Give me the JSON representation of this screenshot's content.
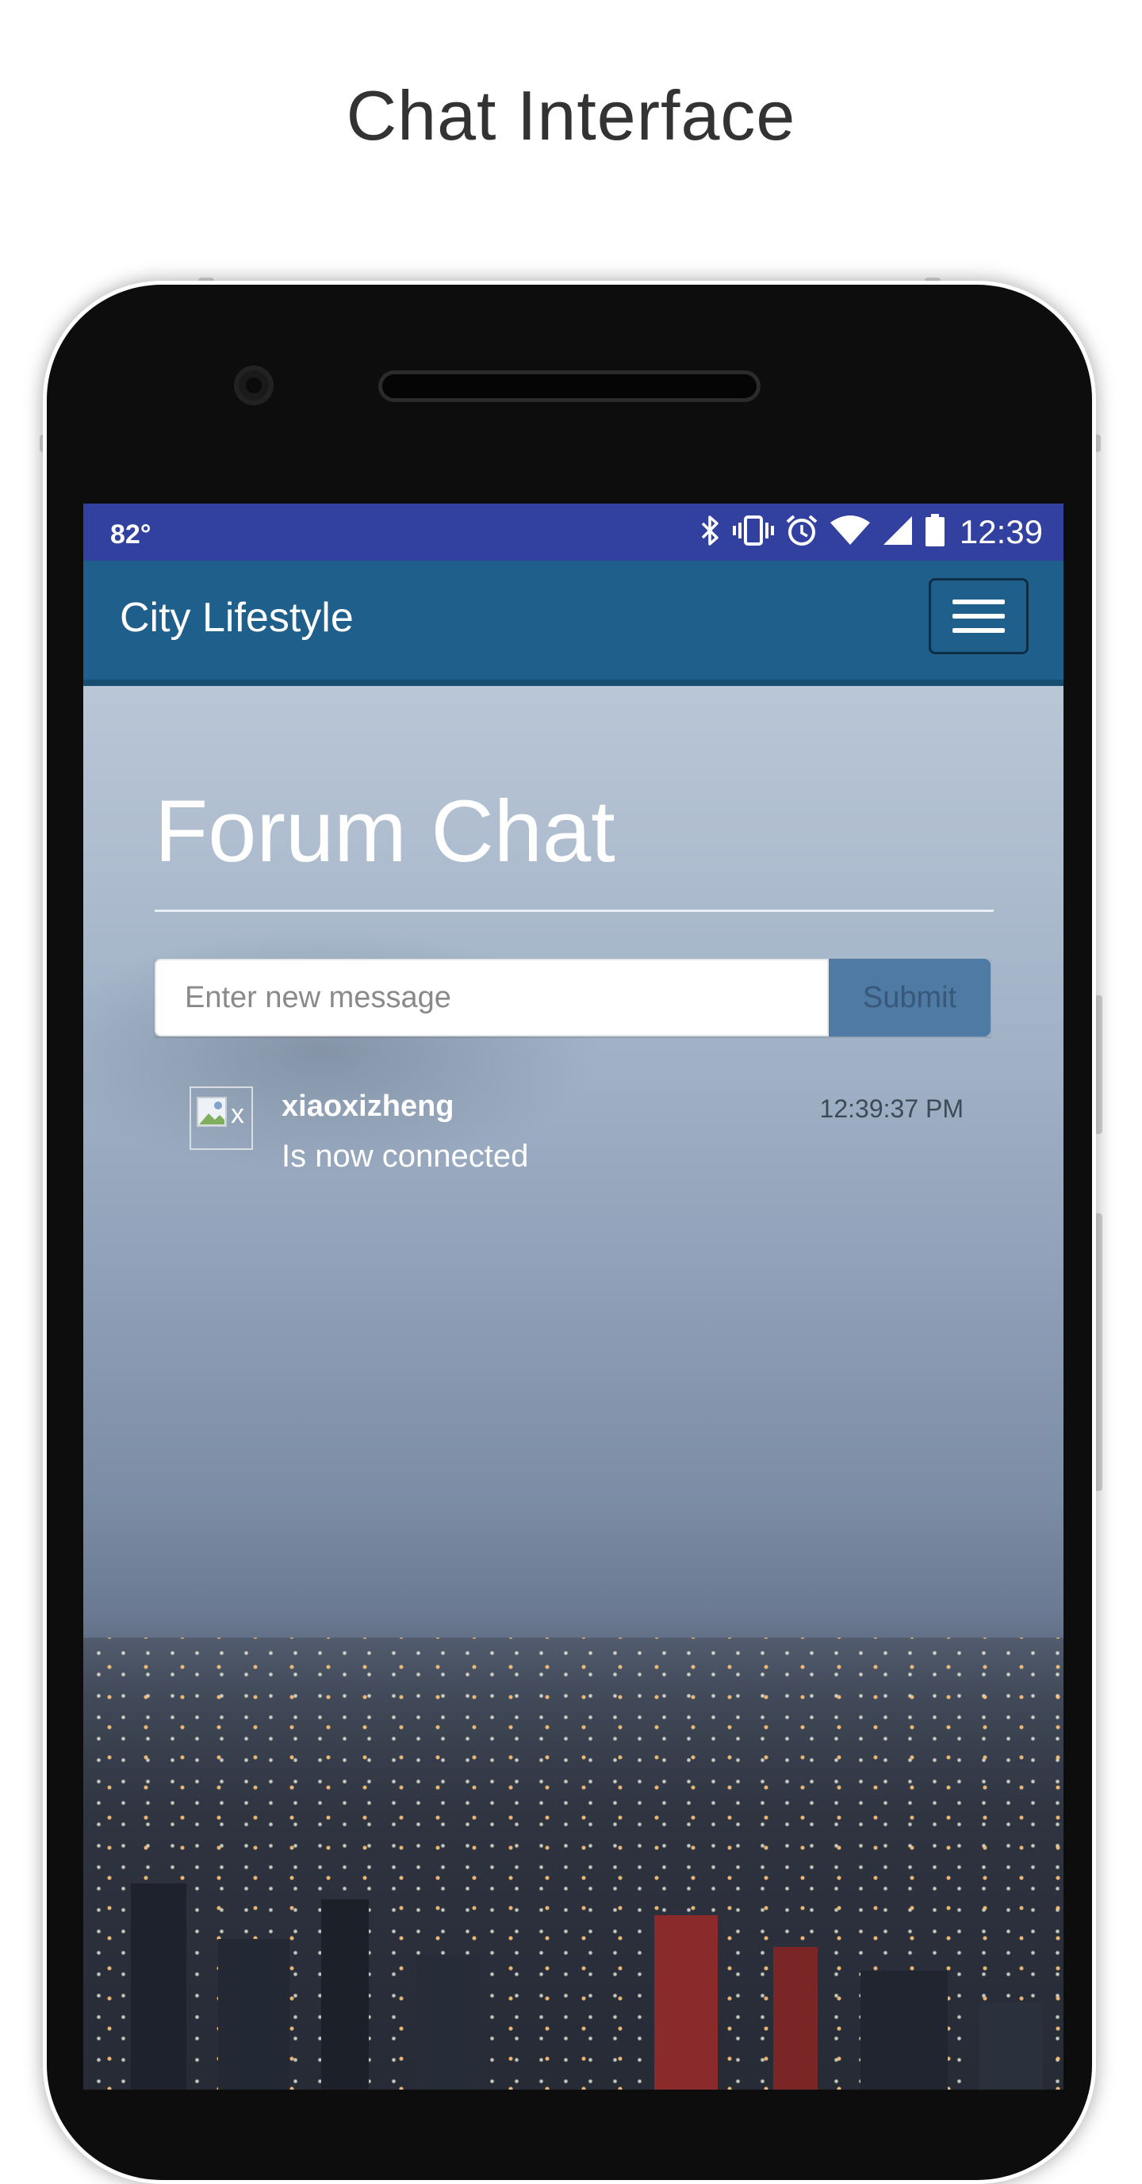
{
  "page": {
    "heading": "Chat Interface"
  },
  "status_bar": {
    "temperature": "82°",
    "time": "12:39",
    "icons": [
      "bluetooth-icon",
      "vibrate-icon",
      "alarm-icon",
      "wifi-icon",
      "signal-icon",
      "battery-icon"
    ],
    "background": "#3240a0"
  },
  "navbar": {
    "brand": "City Lifestyle",
    "menu_icon": "hamburger-menu-icon",
    "background": "#1f5f8b"
  },
  "main": {
    "title": "Forum Chat",
    "form": {
      "placeholder": "Enter new message",
      "value": "",
      "submit_label": "Submit",
      "submit_color": "#4f7aa3"
    },
    "messages": [
      {
        "avatar_icon": "broken-image-icon",
        "avatar_alt": "x",
        "user": "xiaoxizheng",
        "time": "12:39:37 PM",
        "text": "Is now connected"
      }
    ]
  }
}
